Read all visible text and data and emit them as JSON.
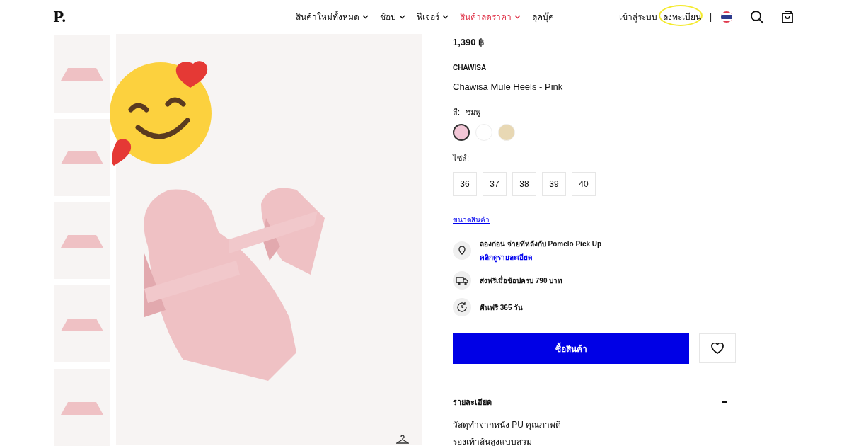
{
  "header": {
    "logo": "P.",
    "nav": [
      {
        "label": "สินค้าใหม่ทั้งหมด",
        "dropdown": true,
        "sale": false
      },
      {
        "label": "ช้อป",
        "dropdown": true,
        "sale": false
      },
      {
        "label": "ฟีเจอร์",
        "dropdown": true,
        "sale": false
      },
      {
        "label": "สินค้าลดราคา",
        "dropdown": true,
        "sale": true
      },
      {
        "label": "ลุคบุ๊ค",
        "dropdown": false,
        "sale": false
      }
    ],
    "login": "เข้าสู่ระบบ",
    "register": "ลงทะเบียน",
    "register_circled": true,
    "separator": "|"
  },
  "product": {
    "price": "1,390 ฿",
    "brand": "CHAWISA",
    "name": "Chawisa Mule Heels - Pink",
    "color_label": "สี:",
    "color_value": "ชมพู",
    "swatches": [
      {
        "color": "#f2c6d6",
        "selected": true
      },
      {
        "color": "#ffffff",
        "selected": false
      },
      {
        "color": "#e8d8b4",
        "selected": false
      }
    ],
    "size_label": "ไซส์:",
    "sizes": [
      "36",
      "37",
      "38",
      "39",
      "40"
    ],
    "size_guide": "ขนาดสินค้า",
    "perks": [
      {
        "kind": "pin",
        "text": "ลองก่อน จ่ายทีหลังกับ Pomelo Pick Up",
        "link": "คลิกดูรายละเอียด"
      },
      {
        "kind": "truck",
        "text": "ส่งฟรีเมื่อช้อปครบ 790 บาท"
      },
      {
        "kind": "return",
        "text": "คืนฟรี 365 วัน"
      }
    ],
    "buy_button": "ซื้อสินค้า",
    "details": {
      "title": "รายละเอียด",
      "expanded": true,
      "lines": [
        "วัสดุทำจากหนัง PU คุณภาพดี",
        "รองเท้าส้นสูงแบบสวม"
      ]
    }
  }
}
